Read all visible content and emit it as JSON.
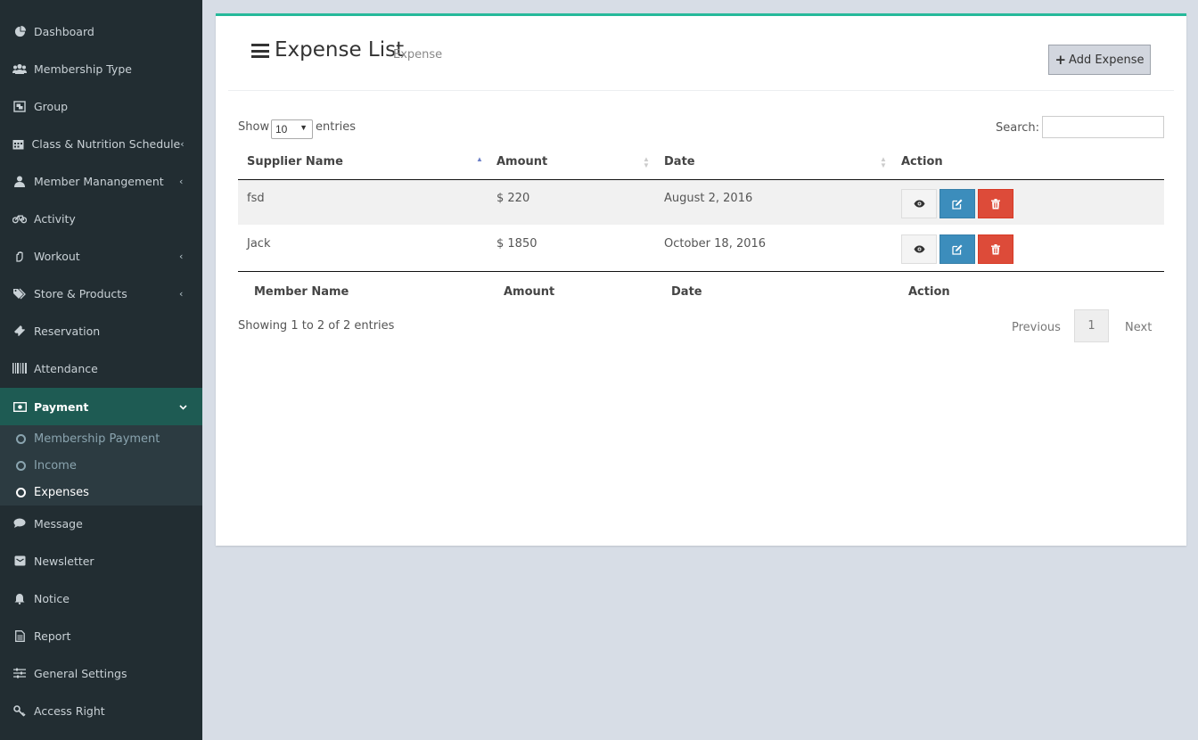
{
  "sidebar": {
    "items": [
      {
        "label": "Dashboard",
        "icon": "pie-chart-icon"
      },
      {
        "label": "Membership Type",
        "icon": "users-icon"
      },
      {
        "label": "Group",
        "icon": "object-group-icon"
      },
      {
        "label": "Class & Nutrition Schedule",
        "icon": "calendar-icon"
      },
      {
        "label": "Member Manangement",
        "icon": "user-icon"
      },
      {
        "label": "Activity",
        "icon": "bicycle-icon"
      },
      {
        "label": "Workout",
        "icon": "hand-icon"
      },
      {
        "label": "Store & Products",
        "icon": "tags-icon"
      },
      {
        "label": "Reservation",
        "icon": "ticket-icon"
      },
      {
        "label": "Attendance",
        "icon": "barcode-icon"
      },
      {
        "label": "Payment",
        "icon": "money-icon"
      },
      {
        "label": "Message",
        "icon": "comment-icon"
      },
      {
        "label": "Newsletter",
        "icon": "envelope-icon"
      },
      {
        "label": "Notice",
        "icon": "bell-icon"
      },
      {
        "label": "Report",
        "icon": "file-text-icon"
      },
      {
        "label": "General Settings",
        "icon": "sliders-icon"
      },
      {
        "label": "Access Right",
        "icon": "key-icon"
      }
    ],
    "payment_submenu": [
      {
        "label": "Membership Payment"
      },
      {
        "label": "Income"
      },
      {
        "label": "Expenses"
      }
    ]
  },
  "header": {
    "title": "Expense List",
    "subtitle": "Expense",
    "add_button": "Add Expense"
  },
  "table_controls": {
    "show_label": "Show",
    "page_length": "10",
    "entries_label": "entries",
    "search_label": "Search:"
  },
  "table": {
    "columns": [
      "Supplier Name",
      "Amount",
      "Date",
      "Action"
    ],
    "footer_columns": [
      "Member Name",
      "Amount",
      "Date",
      "Action"
    ],
    "rows": [
      {
        "supplier": "fsd",
        "amount": "$ 220",
        "date": "August 2, 2016"
      },
      {
        "supplier": "Jack",
        "amount": "$ 1850",
        "date": "October 18, 2016"
      }
    ]
  },
  "pagination": {
    "info": "Showing 1 to 2 of 2 entries",
    "previous": "Previous",
    "current_page": "1",
    "next": "Next"
  },
  "colors": {
    "sidebar_bg": "#222d32",
    "active_bg": "#1e5b53",
    "box_top_border": "#26b99a",
    "edit_button": "#3c8dbc",
    "delete_button": "#dd4b39"
  }
}
